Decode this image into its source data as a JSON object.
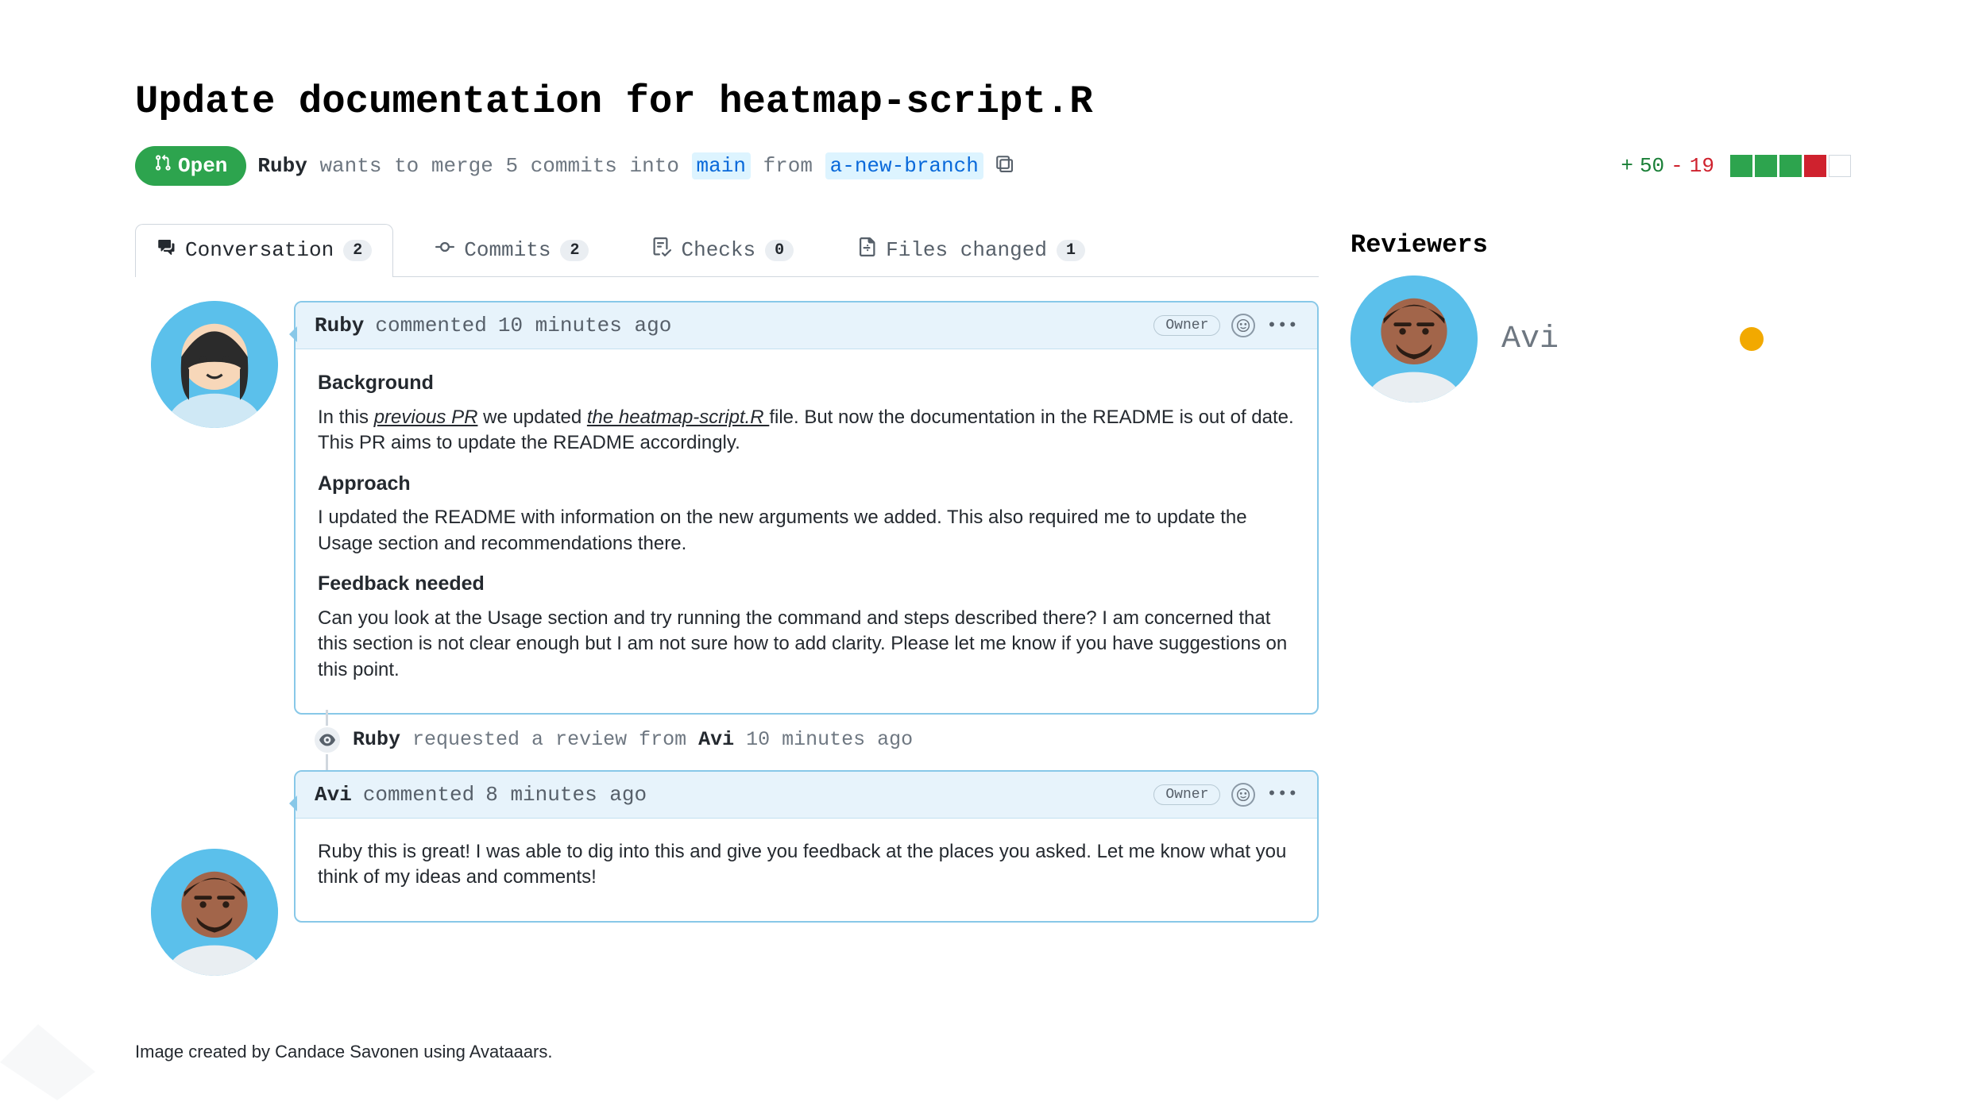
{
  "pr": {
    "title": "Update documentation for heatmap-script.R",
    "state_label": "Open",
    "author": "Ruby",
    "merge_sentence_1": "wants to merge 5 commits into",
    "base_branch": "main",
    "merge_sentence_2": "from",
    "head_branch": "a-new-branch",
    "additions": "50",
    "deletions": "19",
    "diff_square_colors": [
      "g",
      "g",
      "g",
      "r",
      "e"
    ]
  },
  "tabs": [
    {
      "icon": "comment-discussion",
      "label": "Conversation",
      "count": "2",
      "active": true
    },
    {
      "icon": "git-commit",
      "label": "Commits",
      "count": "2",
      "active": false
    },
    {
      "icon": "checklist",
      "label": "Checks",
      "count": "0",
      "active": false
    },
    {
      "icon": "file-diff",
      "label": "Files changed",
      "count": "1",
      "active": false
    }
  ],
  "comments": [
    {
      "avatar": "ruby",
      "author": "Ruby",
      "verb": "commented",
      "time": "10 minutes ago",
      "badge": "Owner",
      "body": {
        "h1": "Background",
        "p1a": " In this ",
        "p1link1": "previous PR",
        "p1b": " we updated ",
        "p1link2": "the heatmap-script.R ",
        "p1c": "file. But now the documentation in the README is out of date. This PR aims to update the README accordingly.",
        "h2": "Approach",
        "p2": "I updated the README with information on the new arguments we added. This also required me to update the Usage section and recommendations there.",
        "h3": "Feedback needed",
        "p3": "Can you look at the Usage section and try running the command and steps described there? I am concerned that this section is not clear enough but I am not sure how to add clarity. Please let me know if you have suggestions on this point."
      }
    },
    {
      "avatar": "avi",
      "author": "Avi",
      "verb": "commented",
      "time": "8 minutes ago",
      "badge": "Owner",
      "body": {
        "p1": "Ruby this is great! I was able to dig into this and give you feedback at the places you asked. Let me know what you think of my ideas and comments!"
      }
    }
  ],
  "timeline_event": {
    "actor": "Ruby",
    "text_1": "requested a review from",
    "reviewer": "Avi",
    "time": "10 minutes ago"
  },
  "sidebar": {
    "reviewers_heading": "Reviewers",
    "reviewers": [
      {
        "name": "Avi",
        "status": "pending"
      }
    ]
  },
  "credit": "Image created by Candace Savonen using Avataaars."
}
